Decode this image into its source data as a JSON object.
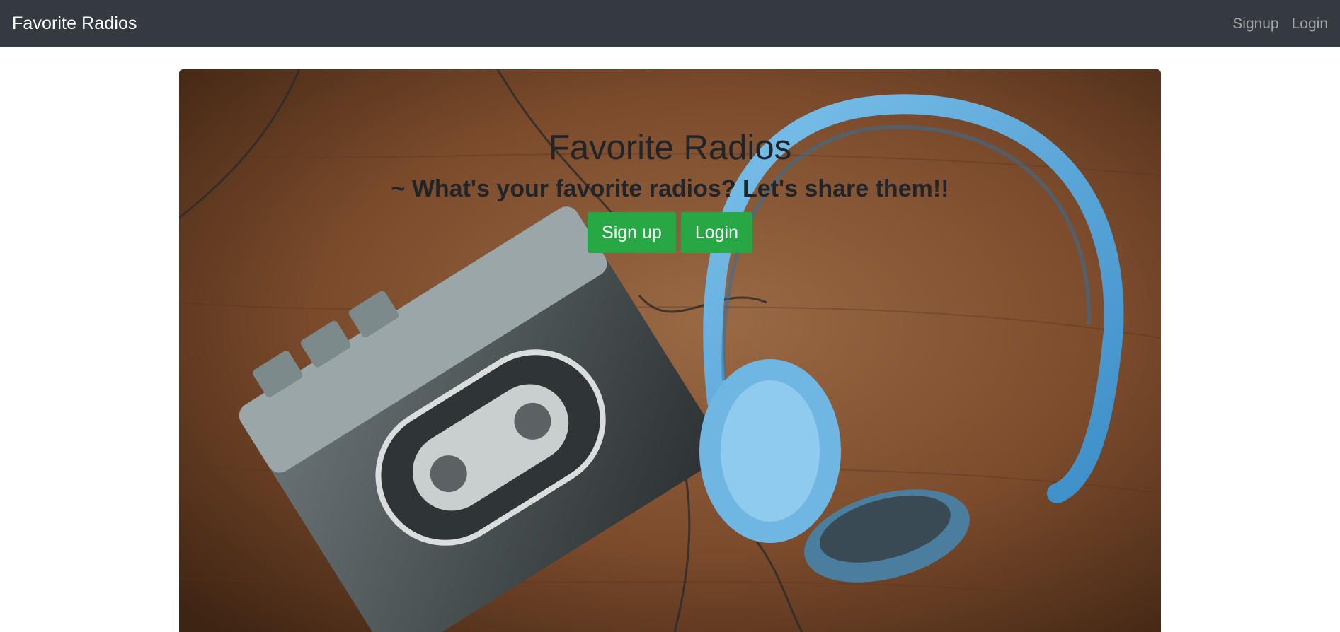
{
  "navbar": {
    "brand": "Favorite Radios",
    "links": [
      "Signup",
      "Login"
    ]
  },
  "hero": {
    "title": "Favorite Radios",
    "subtitle": "~ What's your favorite radios? Let's share them!!",
    "buttons": {
      "signup": "Sign up",
      "login": "Login"
    },
    "image": "cassette player and blue headphones on a wooden table"
  },
  "colors": {
    "navbar_bg": "#343a40",
    "button_green": "#28a745",
    "text_dark": "#212529"
  }
}
